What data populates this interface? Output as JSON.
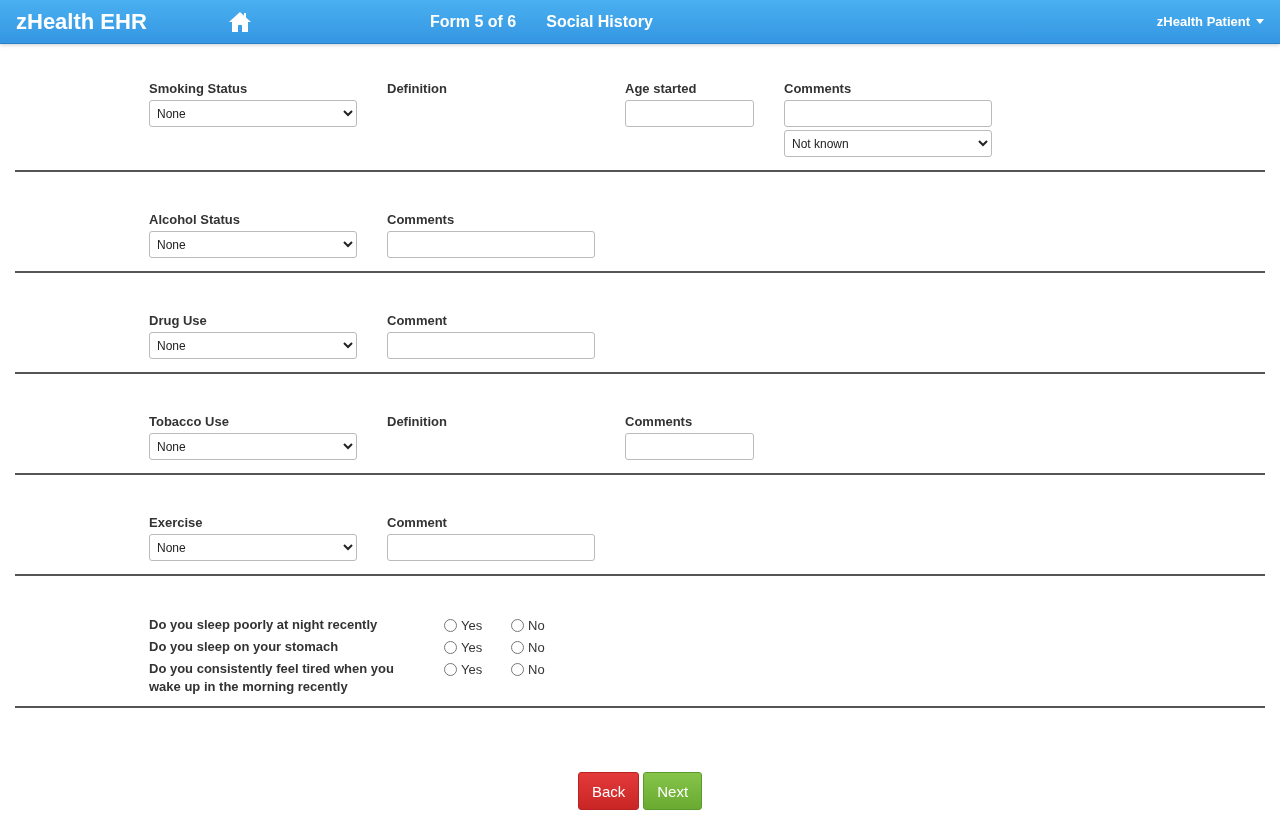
{
  "navbar": {
    "brand": "zHealth EHR",
    "form_step": "Form 5 of 6",
    "form_title": "Social History",
    "user_menu": "zHealth Patient"
  },
  "sections": [
    {
      "fields": [
        {
          "label": "Smoking Status",
          "controls": [
            {
              "kind": "select",
              "value": "None"
            }
          ]
        },
        {
          "label": "Definition"
        },
        {
          "label": "Age started",
          "controls": [
            {
              "kind": "text"
            }
          ]
        },
        {
          "label": "Comments",
          "controls": [
            {
              "kind": "text"
            },
            {
              "kind": "select",
              "value": "Not known"
            }
          ]
        }
      ]
    },
    {
      "fields": [
        {
          "label": "Alcohol Status",
          "controls": [
            {
              "kind": "select",
              "value": "None"
            }
          ]
        },
        {
          "label": "Comments",
          "controls": [
            {
              "kind": "text"
            }
          ]
        }
      ]
    },
    {
      "fields": [
        {
          "label": "Drug Use",
          "controls": [
            {
              "kind": "select",
              "value": "None"
            }
          ]
        },
        {
          "label": "Comment",
          "controls": [
            {
              "kind": "text"
            }
          ]
        }
      ]
    },
    {
      "fields": [
        {
          "label": "Tobacco Use",
          "controls": [
            {
              "kind": "select",
              "value": "None"
            }
          ]
        },
        {
          "label": "Definition"
        },
        {
          "label": "Comments",
          "controls": [
            {
              "kind": "text"
            }
          ]
        }
      ]
    },
    {
      "fields": [
        {
          "label": "Exercise",
          "controls": [
            {
              "kind": "select",
              "value": "None"
            }
          ]
        },
        {
          "label": "Comment",
          "controls": [
            {
              "kind": "text"
            }
          ]
        }
      ]
    }
  ],
  "questions": [
    {
      "text": "Do you sleep poorly at night recently",
      "options": [
        {
          "label": "Yes",
          "selected": false
        },
        {
          "label": "No",
          "selected": false
        }
      ]
    },
    {
      "text": "Do you sleep on your stomach",
      "options": [
        {
          "label": "Yes",
          "selected": false
        },
        {
          "label": "No",
          "selected": false
        }
      ]
    },
    {
      "text": "Do you consistently feel tired when you wake up in the morning recently",
      "options": [
        {
          "label": "Yes",
          "selected": false
        },
        {
          "label": "No",
          "selected": false
        }
      ]
    }
  ],
  "buttons": [
    {
      "label": "Back",
      "kind": "back"
    },
    {
      "label": "Next",
      "kind": "next"
    }
  ]
}
